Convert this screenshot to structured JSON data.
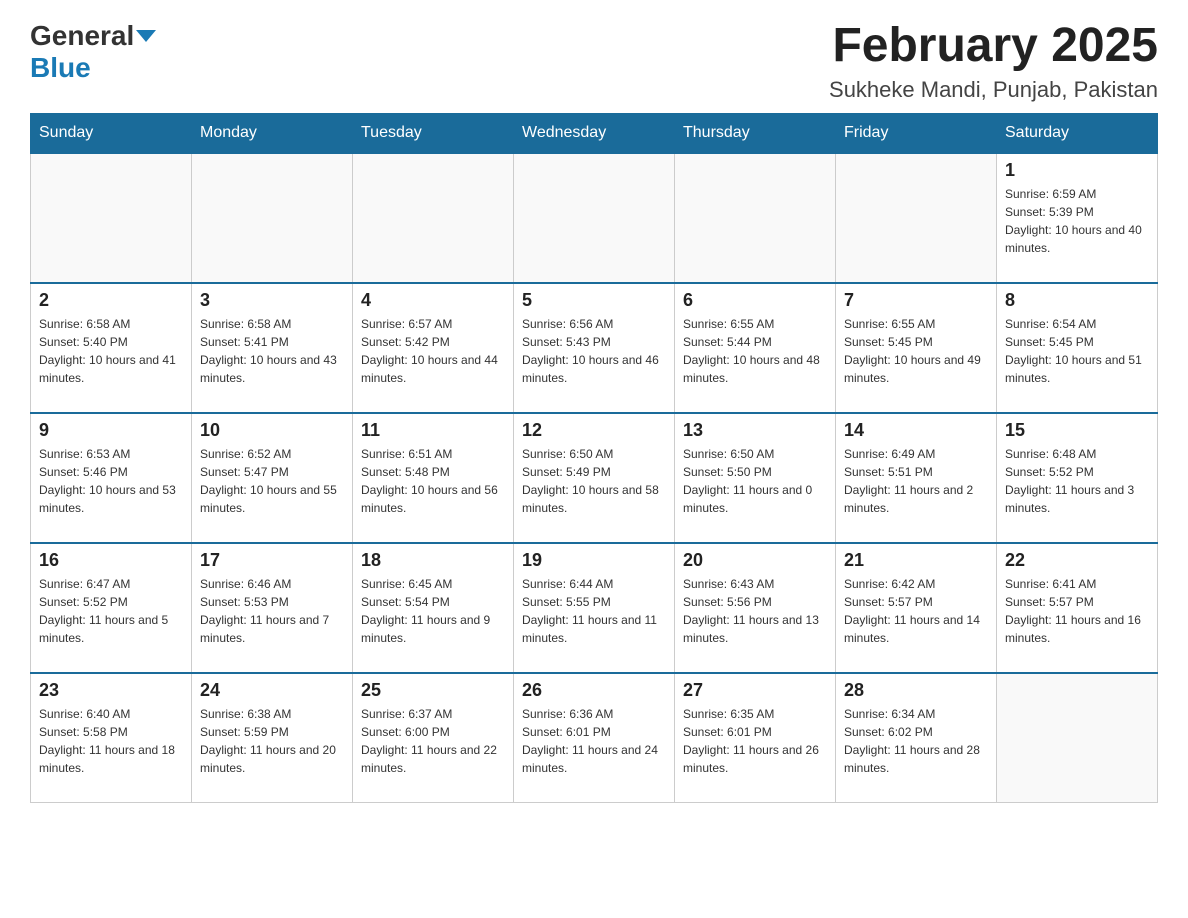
{
  "logo": {
    "general": "General",
    "blue": "Blue"
  },
  "header": {
    "month_year": "February 2025",
    "location": "Sukheke Mandi, Punjab, Pakistan"
  },
  "weekdays": [
    "Sunday",
    "Monday",
    "Tuesday",
    "Wednesday",
    "Thursday",
    "Friday",
    "Saturday"
  ],
  "weeks": [
    [
      {
        "day": "",
        "info": ""
      },
      {
        "day": "",
        "info": ""
      },
      {
        "day": "",
        "info": ""
      },
      {
        "day": "",
        "info": ""
      },
      {
        "day": "",
        "info": ""
      },
      {
        "day": "",
        "info": ""
      },
      {
        "day": "1",
        "info": "Sunrise: 6:59 AM\nSunset: 5:39 PM\nDaylight: 10 hours and 40 minutes."
      }
    ],
    [
      {
        "day": "2",
        "info": "Sunrise: 6:58 AM\nSunset: 5:40 PM\nDaylight: 10 hours and 41 minutes."
      },
      {
        "day": "3",
        "info": "Sunrise: 6:58 AM\nSunset: 5:41 PM\nDaylight: 10 hours and 43 minutes."
      },
      {
        "day": "4",
        "info": "Sunrise: 6:57 AM\nSunset: 5:42 PM\nDaylight: 10 hours and 44 minutes."
      },
      {
        "day": "5",
        "info": "Sunrise: 6:56 AM\nSunset: 5:43 PM\nDaylight: 10 hours and 46 minutes."
      },
      {
        "day": "6",
        "info": "Sunrise: 6:55 AM\nSunset: 5:44 PM\nDaylight: 10 hours and 48 minutes."
      },
      {
        "day": "7",
        "info": "Sunrise: 6:55 AM\nSunset: 5:45 PM\nDaylight: 10 hours and 49 minutes."
      },
      {
        "day": "8",
        "info": "Sunrise: 6:54 AM\nSunset: 5:45 PM\nDaylight: 10 hours and 51 minutes."
      }
    ],
    [
      {
        "day": "9",
        "info": "Sunrise: 6:53 AM\nSunset: 5:46 PM\nDaylight: 10 hours and 53 minutes."
      },
      {
        "day": "10",
        "info": "Sunrise: 6:52 AM\nSunset: 5:47 PM\nDaylight: 10 hours and 55 minutes."
      },
      {
        "day": "11",
        "info": "Sunrise: 6:51 AM\nSunset: 5:48 PM\nDaylight: 10 hours and 56 minutes."
      },
      {
        "day": "12",
        "info": "Sunrise: 6:50 AM\nSunset: 5:49 PM\nDaylight: 10 hours and 58 minutes."
      },
      {
        "day": "13",
        "info": "Sunrise: 6:50 AM\nSunset: 5:50 PM\nDaylight: 11 hours and 0 minutes."
      },
      {
        "day": "14",
        "info": "Sunrise: 6:49 AM\nSunset: 5:51 PM\nDaylight: 11 hours and 2 minutes."
      },
      {
        "day": "15",
        "info": "Sunrise: 6:48 AM\nSunset: 5:52 PM\nDaylight: 11 hours and 3 minutes."
      }
    ],
    [
      {
        "day": "16",
        "info": "Sunrise: 6:47 AM\nSunset: 5:52 PM\nDaylight: 11 hours and 5 minutes."
      },
      {
        "day": "17",
        "info": "Sunrise: 6:46 AM\nSunset: 5:53 PM\nDaylight: 11 hours and 7 minutes."
      },
      {
        "day": "18",
        "info": "Sunrise: 6:45 AM\nSunset: 5:54 PM\nDaylight: 11 hours and 9 minutes."
      },
      {
        "day": "19",
        "info": "Sunrise: 6:44 AM\nSunset: 5:55 PM\nDaylight: 11 hours and 11 minutes."
      },
      {
        "day": "20",
        "info": "Sunrise: 6:43 AM\nSunset: 5:56 PM\nDaylight: 11 hours and 13 minutes."
      },
      {
        "day": "21",
        "info": "Sunrise: 6:42 AM\nSunset: 5:57 PM\nDaylight: 11 hours and 14 minutes."
      },
      {
        "day": "22",
        "info": "Sunrise: 6:41 AM\nSunset: 5:57 PM\nDaylight: 11 hours and 16 minutes."
      }
    ],
    [
      {
        "day": "23",
        "info": "Sunrise: 6:40 AM\nSunset: 5:58 PM\nDaylight: 11 hours and 18 minutes."
      },
      {
        "day": "24",
        "info": "Sunrise: 6:38 AM\nSunset: 5:59 PM\nDaylight: 11 hours and 20 minutes."
      },
      {
        "day": "25",
        "info": "Sunrise: 6:37 AM\nSunset: 6:00 PM\nDaylight: 11 hours and 22 minutes."
      },
      {
        "day": "26",
        "info": "Sunrise: 6:36 AM\nSunset: 6:01 PM\nDaylight: 11 hours and 24 minutes."
      },
      {
        "day": "27",
        "info": "Sunrise: 6:35 AM\nSunset: 6:01 PM\nDaylight: 11 hours and 26 minutes."
      },
      {
        "day": "28",
        "info": "Sunrise: 6:34 AM\nSunset: 6:02 PM\nDaylight: 11 hours and 28 minutes."
      },
      {
        "day": "",
        "info": ""
      }
    ]
  ]
}
